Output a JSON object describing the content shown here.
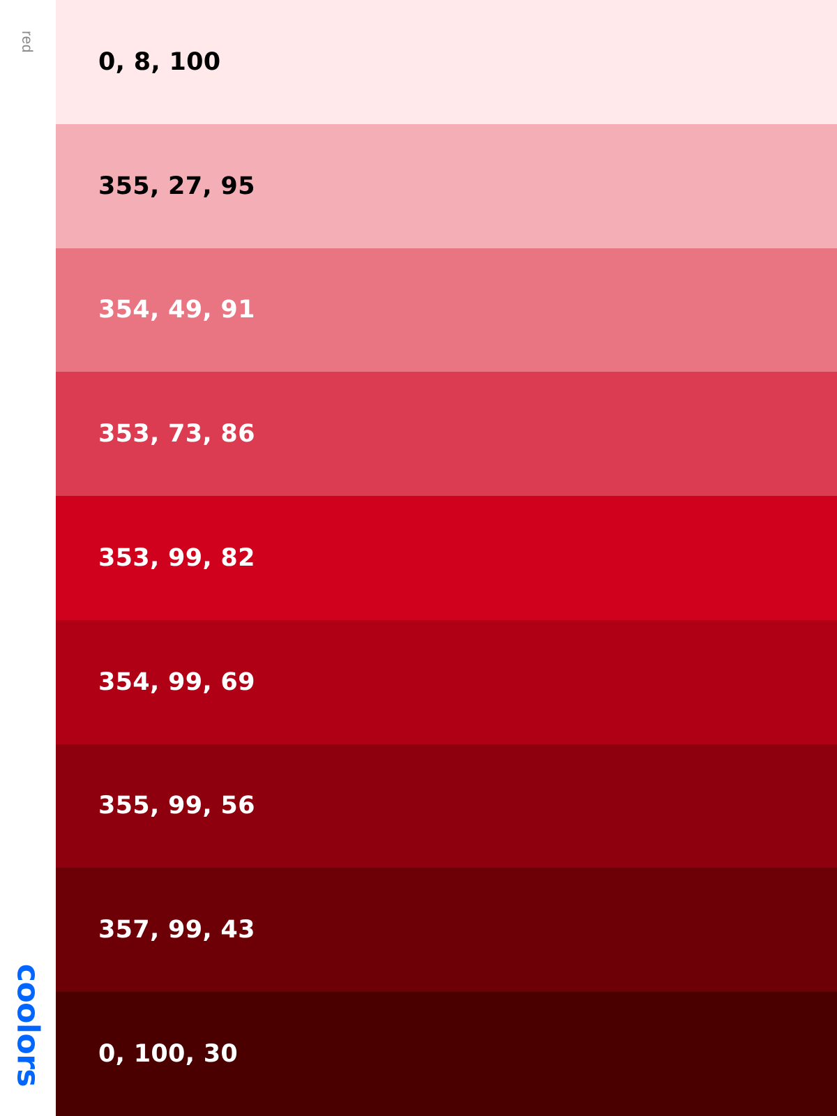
{
  "sidebar": {
    "palette_name": "red",
    "brand": "coolors",
    "brand_color": "#0066ff"
  },
  "swatches": [
    {
      "label": "0, 8, 100",
      "color": "#ffe9ea",
      "text_color": "#000000"
    },
    {
      "label": "355, 27, 95",
      "color": "#f3afb5",
      "text_color": "#000000"
    },
    {
      "label": "354, 49, 91",
      "color": "#e87581",
      "text_color": "#ffffff"
    },
    {
      "label": "353, 73, 86",
      "color": "#dc3c51",
      "text_color": "#ffffff"
    },
    {
      "label": "353, 99, 82",
      "color": "#cf011c",
      "text_color": "#ffffff"
    },
    {
      "label": "354, 99, 69",
      "color": "#b00016",
      "text_color": "#ffffff"
    },
    {
      "label": "355, 99, 56",
      "color": "#8f000f",
      "text_color": "#ffffff"
    },
    {
      "label": "357, 99, 43",
      "color": "#6d0007",
      "text_color": "#ffffff"
    },
    {
      "label": "0, 100, 30",
      "color": "#4b0000",
      "text_color": "#ffffff"
    }
  ]
}
